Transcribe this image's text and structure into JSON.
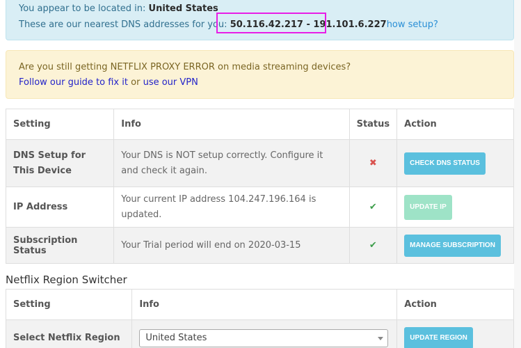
{
  "location_alert": {
    "location_prefix": "You appear to be located in:",
    "location": "United States",
    "dns_prefix": "These are our nearest DNS addresses for you:",
    "dns_ips": "50.116.42.217 - 191.101.6.227",
    "setup_link": "how setup?"
  },
  "proxy_alert": {
    "question": "Are you still getting NETFLIX PROXY ERROR on media streaming devices?",
    "guide_link": "Follow our guide to fix it",
    "or_text": "or",
    "vpn_link": "use our VPN"
  },
  "settings_table": {
    "headers": [
      "Setting",
      "Info",
      "Status",
      "Action"
    ],
    "rows": [
      {
        "setting": "DNS Setup for This Device",
        "info": "Your DNS is NOT setup correctly. Configure it and check it again.",
        "status": "✖",
        "action": "CHECK DNS STATUS"
      },
      {
        "setting": "IP Address",
        "info": "Your current IP address 104.247.196.164 is updated.",
        "status": "✔",
        "action": "UPDATE IP"
      },
      {
        "setting": "Subscription Status",
        "info": "Your Trial period will end on 2020-03-15",
        "status": "✔",
        "action": "MANAGE SUBSCRIPTION"
      }
    ]
  },
  "region_switcher": {
    "title": "Netflix Region Switcher",
    "headers": [
      "Setting",
      "Info",
      "Action"
    ],
    "row": {
      "setting": "Select Netflix Region",
      "selected": "United States",
      "action": "UPDATE REGION"
    }
  },
  "colors": {
    "info_bg": "#d9eef5",
    "warning_bg": "#fcf3d6",
    "button": "#5bc0de",
    "button_disabled": "#9ee3c7",
    "highlight": "#e81ee6"
  }
}
